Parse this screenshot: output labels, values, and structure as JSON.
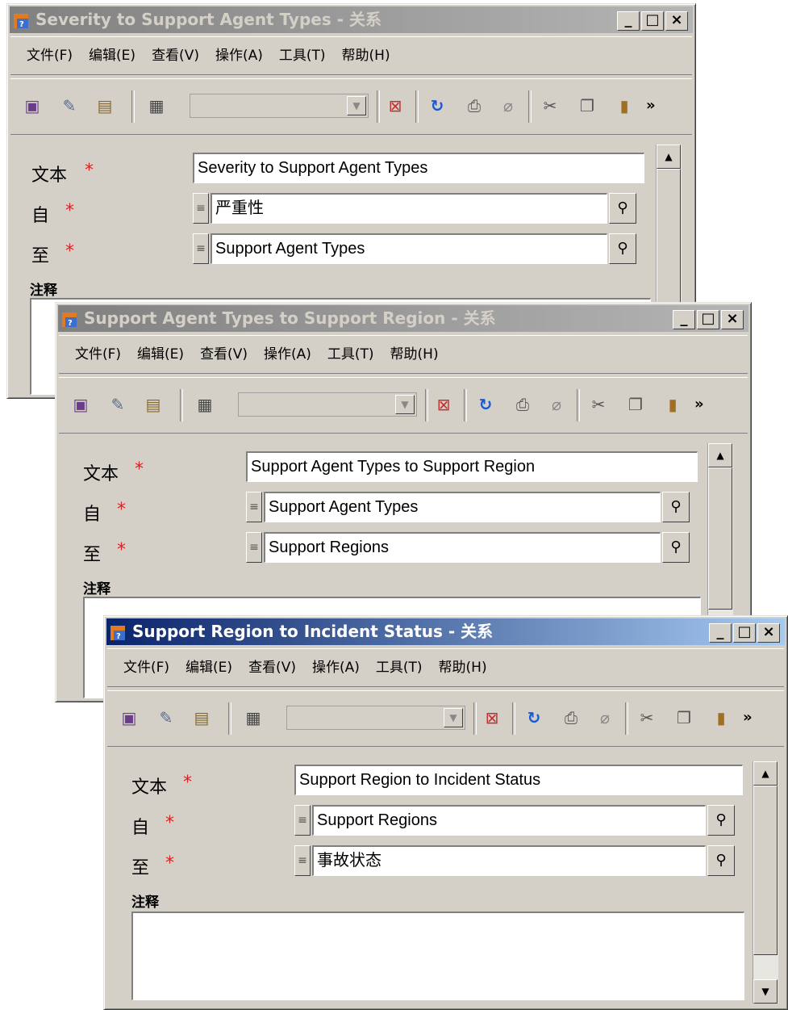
{
  "windows": [
    {
      "title": "Severity to Support Agent Types - 关系",
      "active": false,
      "menu": [
        "文件(F)",
        "编辑(E)",
        "查看(V)",
        "操作(A)",
        "工具(T)",
        "帮助(H)"
      ],
      "fields": {
        "text_label": "文本",
        "text_value": "Severity to Support Agent Types",
        "from_label": "自",
        "from_value": "严重性",
        "to_label": "至",
        "to_value": "Support Agent Types",
        "note_label": "注释",
        "required_mark": "*"
      }
    },
    {
      "title": "Support Agent Types to Support Region - 关系",
      "active": false,
      "menu": [
        "文件(F)",
        "编辑(E)",
        "查看(V)",
        "操作(A)",
        "工具(T)",
        "帮助(H)"
      ],
      "fields": {
        "text_label": "文本",
        "text_value": "Support Agent Types to Support Region",
        "from_label": "自",
        "from_value": "Support Agent Types",
        "to_label": "至",
        "to_value": "Support Regions",
        "note_label": "注释",
        "required_mark": "*"
      }
    },
    {
      "title": "Support Region to Incident Status - 关系",
      "active": true,
      "menu": [
        "文件(F)",
        "编辑(E)",
        "查看(V)",
        "操作(A)",
        "工具(T)",
        "帮助(H)"
      ],
      "fields": {
        "text_label": "文本",
        "text_value": "Support Region to Incident Status",
        "from_label": "自",
        "from_value": "Support Regions",
        "to_label": "至",
        "to_value": "事故状态",
        "note_label": "注释",
        "required_mark": "*"
      }
    }
  ],
  "window_buttons": {
    "minimize": "_",
    "maximize": "□",
    "close": "×"
  },
  "toolbar_more": "»",
  "icons": [
    "save-icon",
    "edit-icon",
    "copy-record-icon",
    "properties-icon",
    "delete-icon",
    "refresh-icon",
    "print-icon",
    "attach-icon",
    "cut-icon",
    "copy-icon",
    "paste-icon",
    "lookup-icon"
  ]
}
